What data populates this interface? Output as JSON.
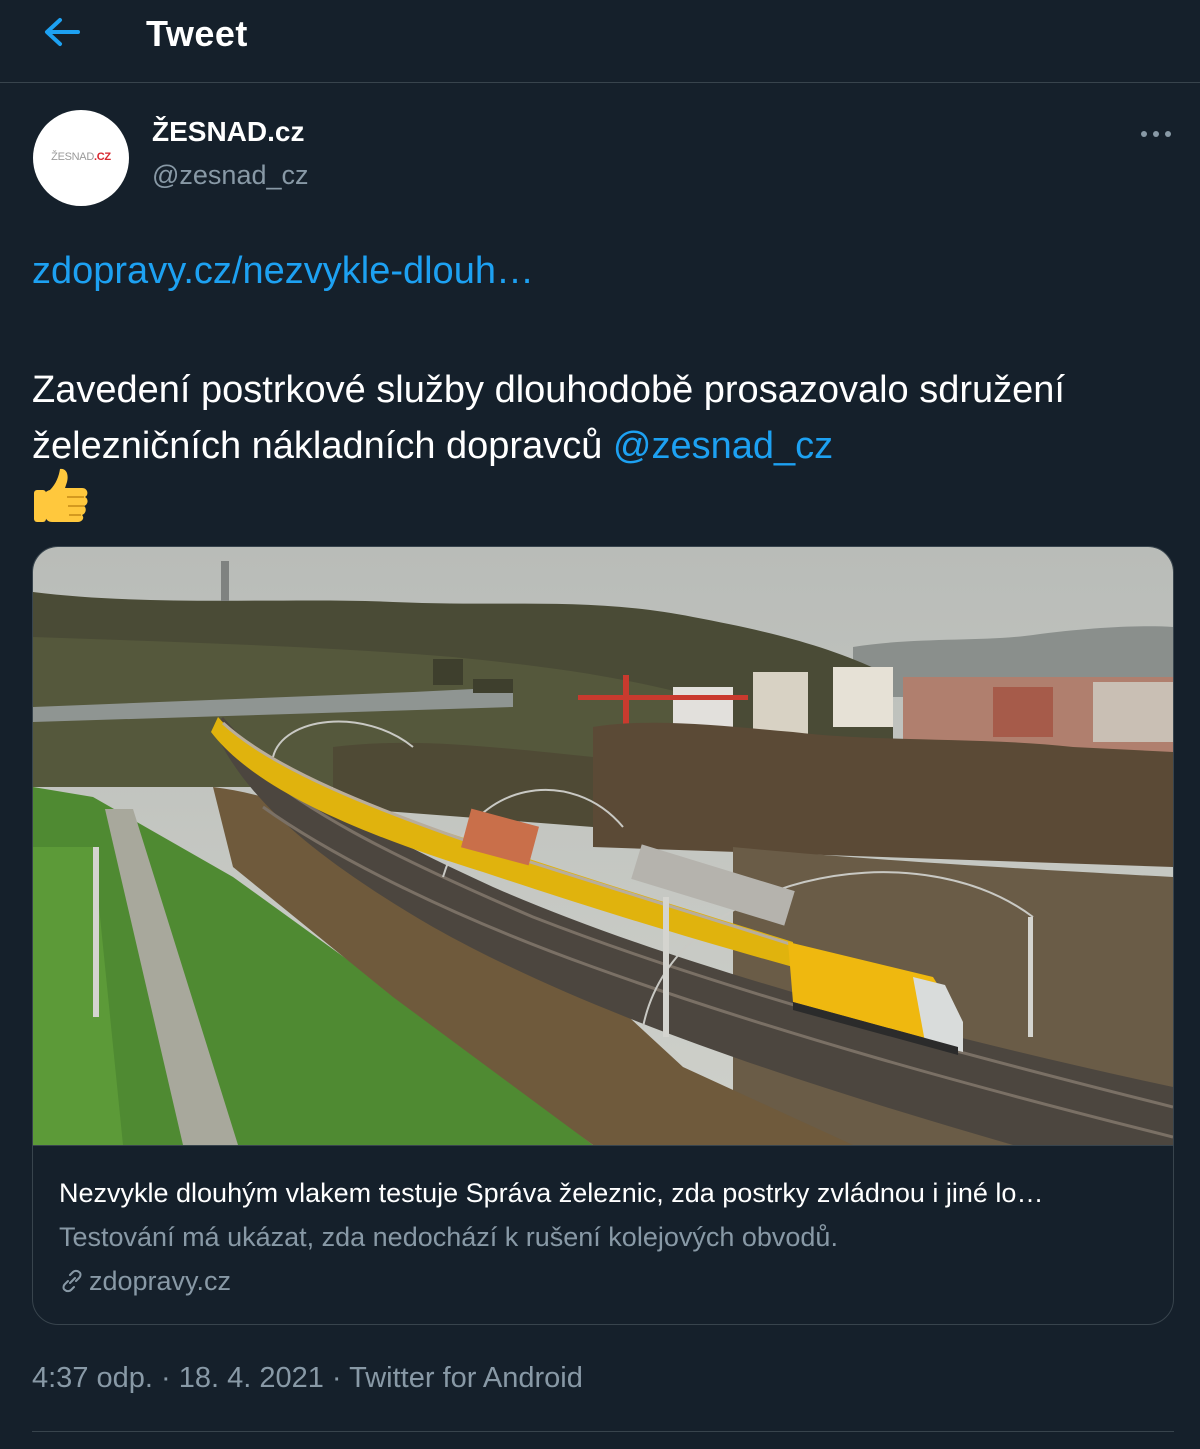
{
  "header": {
    "title": "Tweet"
  },
  "tweet": {
    "author": {
      "display_name": "ŽESNAD.cz",
      "handle": "@zesnad_cz",
      "avatar_logo": {
        "part1": "ŽESNAD",
        "part2": ".CZ"
      }
    },
    "link_text": "zdopravy.cz/nezvykle-dlouh…",
    "text_before_mention": "Zavedení postrkové služby dlouhodobě prosazovalo sdružení železničních nákladních dopravců ",
    "mention": "@zesnad_cz",
    "emoji": "thumbs-up",
    "card": {
      "title": "Nezvykle dlouhým vlakem testuje Správa železnic, zda postrky zvládnou i jiné lo…",
      "description": "Testování má ukázat, zda nedochází k rušení kolejových obvodů.",
      "domain": "zdopravy.cz"
    },
    "meta": {
      "time": "4:37 odp.",
      "separator": " · ",
      "date": "18. 4. 2021",
      "source": "Twitter for Android"
    }
  },
  "colors": {
    "background": "#15202b",
    "accent": "#1da1f2",
    "secondary_text": "#8899a6",
    "border": "#38444d"
  }
}
